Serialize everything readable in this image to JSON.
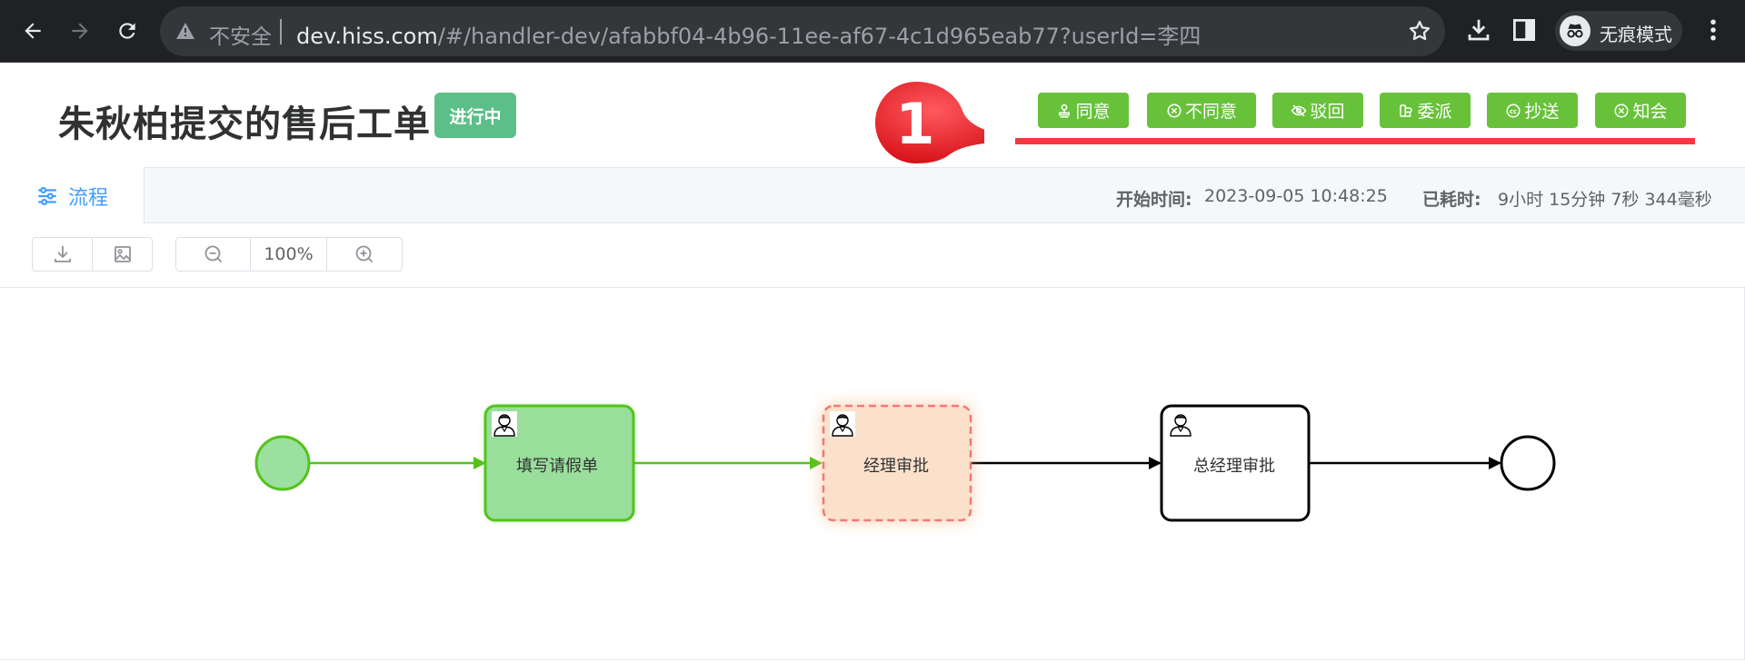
{
  "browser": {
    "insecure_label": "不安全",
    "url_host": "dev.hiss.com",
    "url_path": "/#/handler-dev/afabbf04-4b96-11ee-af67-4c1d965eab77?userId=李四",
    "incognito_label": "无痕模式",
    "icons": [
      "back-icon",
      "forward-icon",
      "reload-icon",
      "warning-icon",
      "star-icon",
      "download-icon",
      "sidepanel-icon",
      "incognito-icon",
      "kebab-menu-icon"
    ]
  },
  "header": {
    "title": "朱秋柏提交的售后工单",
    "status": "进行中",
    "status_color": "#5dbf88"
  },
  "actions": [
    {
      "label": "同意",
      "icon": "stamp-icon"
    },
    {
      "label": "不同意",
      "icon": "circle-x-icon"
    },
    {
      "label": "驳回",
      "icon": "eye-off-icon"
    },
    {
      "label": "委派",
      "icon": "delegate-icon"
    },
    {
      "label": "抄送",
      "icon": "cc-icon"
    },
    {
      "label": "知会",
      "icon": "circle-x-icon"
    }
  ],
  "action_color": "#67c23a",
  "annotation": {
    "number": "1",
    "color": "#f1393f"
  },
  "tabs": [
    {
      "label": "流程",
      "icon": "sliders-icon",
      "active": true
    }
  ],
  "info": {
    "start_label": "开始时间:",
    "start_value": "2023-09-05 10:48:25",
    "elapsed_label": "已耗时:",
    "elapsed_value": "9小时 15分钟 7秒 344毫秒"
  },
  "toolbar": {
    "zoom": "100%",
    "icons": [
      "download-icon",
      "image-icon",
      "zoom-out-icon",
      "zoom-in-icon"
    ]
  },
  "flow": {
    "nodes": [
      {
        "label": "",
        "type": "start",
        "state": "completed"
      },
      {
        "label": "填写请假单",
        "type": "user-task",
        "state": "completed"
      },
      {
        "label": "经理审批",
        "type": "user-task",
        "state": "active"
      },
      {
        "label": "总经理审批",
        "type": "user-task",
        "state": "pending"
      },
      {
        "label": "",
        "type": "end",
        "state": "pending"
      }
    ],
    "colors": {
      "completed": "#52c41a",
      "active": "#f2787a",
      "pending": "#000000"
    }
  }
}
